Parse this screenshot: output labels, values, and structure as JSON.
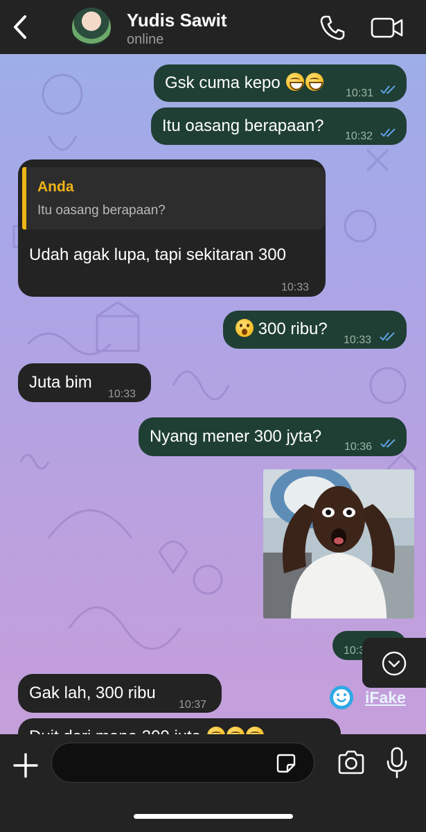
{
  "header": {
    "contact_name": "Yudis Sawit",
    "status": "online"
  },
  "messages": [
    {
      "direction": "out",
      "text": "Gsk cuma kepo",
      "emoji": [
        "grin",
        "grin"
      ],
      "time": "10:31",
      "read": true
    },
    {
      "direction": "out",
      "text": "Itu oasang berapaan?",
      "time": "10:32",
      "read": true
    },
    {
      "direction": "in",
      "reply": {
        "author": "Anda",
        "text": "Itu oasang berapaan?"
      },
      "text": "Udah agak lupa, tapi sekitaran 300",
      "time": "10:33"
    },
    {
      "direction": "out",
      "emoji": [
        "shock"
      ],
      "text": "300 ribu?",
      "time": "10:33",
      "read": true
    },
    {
      "direction": "in",
      "text": "Juta bim",
      "time": "10:33"
    },
    {
      "direction": "out",
      "text": "Nyang mener 300 jyta?",
      "time": "10:36",
      "read": true
    },
    {
      "direction": "out",
      "type": "photo"
    },
    {
      "direction": "out",
      "text": "",
      "time": "10:3",
      "read": true
    },
    {
      "direction": "in",
      "text": "Gak lah, 300 ribu",
      "time": "10:37"
    },
    {
      "direction": "in",
      "text": "Duit dari mana 300 juta",
      "emoji": [
        "grin",
        "grin",
        "grin"
      ],
      "partial": true
    }
  ],
  "watermark": "iFake",
  "composer": {
    "placeholder": ""
  },
  "colors": {
    "header_bg": "#232323",
    "outgoing_bubble": "#1f3f34",
    "incoming_bubble": "#232323",
    "reply_accent": "#f0b416",
    "read_ticks": "#5ea3e6"
  },
  "icons": [
    "back-icon",
    "phone-icon",
    "video-camera-icon",
    "double-check-icon",
    "chevron-down-icon",
    "plus-icon",
    "sticker-icon",
    "camera-icon",
    "microphone-icon"
  ]
}
